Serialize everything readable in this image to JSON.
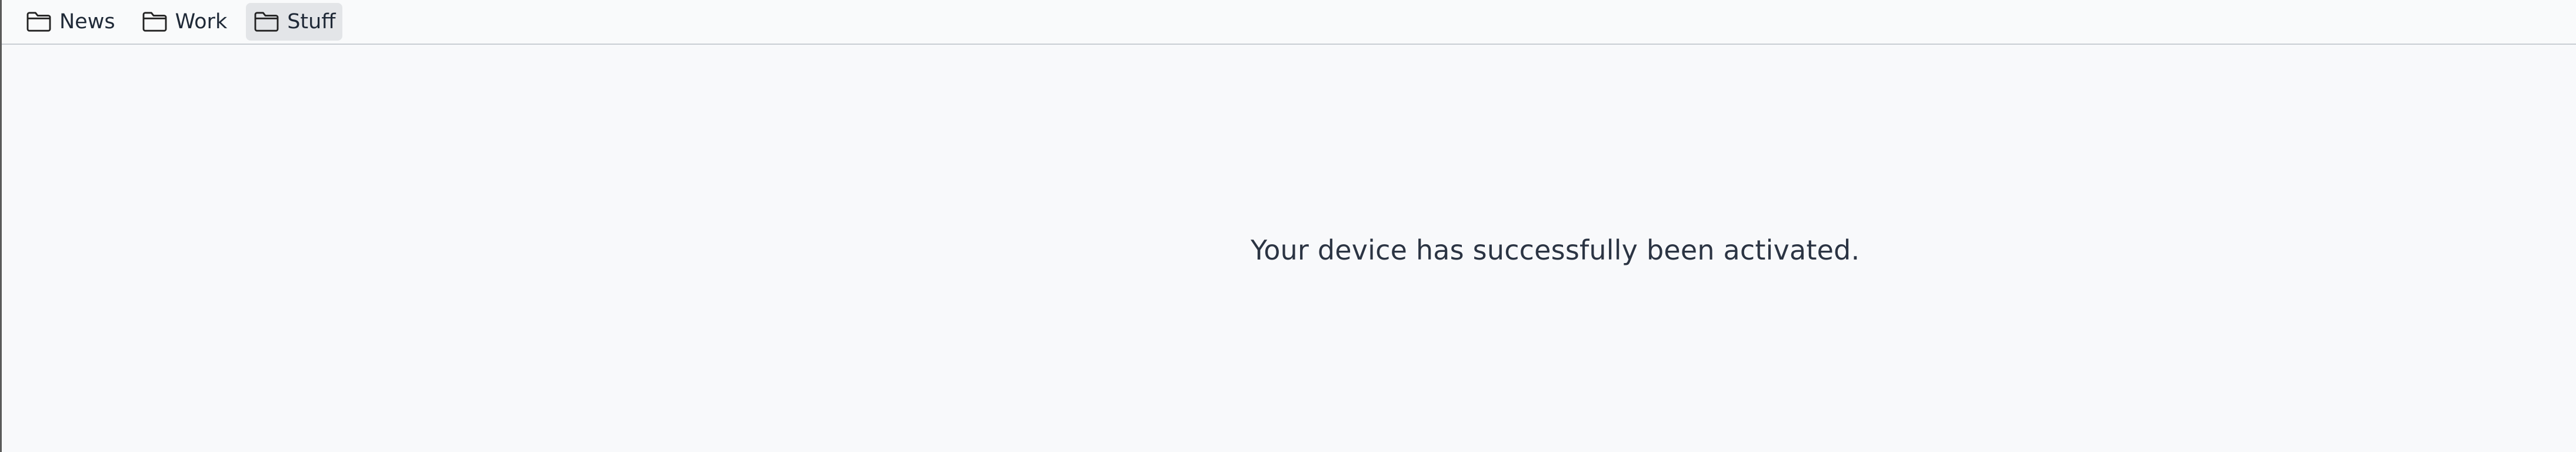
{
  "bookmarks_bar": {
    "items": [
      {
        "label": "News",
        "icon": "folder-icon"
      },
      {
        "label": "Work",
        "icon": "folder-icon"
      },
      {
        "label": "Stuff",
        "icon": "folder-icon",
        "active": true
      }
    ]
  },
  "main": {
    "message": "Your device has successfully been activated."
  },
  "colors": {
    "page_background": "#f8f9fb",
    "active_bookmark_background": "#e3e5e8",
    "text": "#2b3443",
    "divider": "#c9cdd3"
  }
}
